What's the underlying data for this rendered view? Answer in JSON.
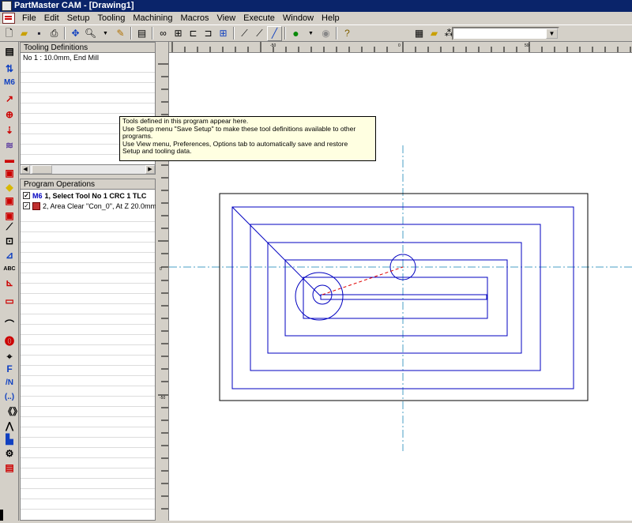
{
  "window": {
    "title": "PartMaster CAM - [Drawing1]"
  },
  "menu": [
    "File",
    "Edit",
    "Setup",
    "Tooling",
    "Machining",
    "Macros",
    "View",
    "Execute",
    "Window",
    "Help"
  ],
  "toolbar": {
    "icons": [
      "new-file-icon",
      "open-folder-icon",
      "save-icon",
      "print-icon",
      "pan-icon",
      "zoom-icon",
      "dropdown-arrow-icon",
      "pencil-icon",
      "grid-icon",
      "glasses-icon",
      "view-select-icon",
      "view-front-icon",
      "view-side-icon",
      "view-top-icon",
      "edit-curve-icon",
      "edit-shape-icon",
      "line-icon",
      "green-dot-icon",
      "dropdown-arrow-icon",
      "stop-icon",
      "help-icon",
      "settings-icon",
      "folder-icon",
      "network-icon",
      "window-icon"
    ],
    "combo_value": ""
  },
  "left_strip_icons": [
    "tool-list-icon",
    "axis-icon",
    "m6-icon",
    "arrow-icon",
    "circle-cross-icon",
    "drill-icon",
    "pattern-icon",
    "face-mill-icon",
    "pocket-icon",
    "profile-icon",
    "area-clear-icon",
    "engrave-icon",
    "pencil-icon",
    "box-icon",
    "slot-icon",
    "text-icon",
    "axis-angle-icon",
    "counter-icon",
    "coolant-icon",
    "stop-icon",
    "spindle-icon",
    "feed-icon",
    "sequence-icon",
    "bracket-icon",
    "comment-icon",
    "lightning-icon",
    "fixture-icon",
    "tool-change-icon",
    "program-icon"
  ],
  "left_strip_labels": {
    "m6": "M6",
    "feed": "F",
    "sequence": "/N",
    "bracket": "(..)"
  },
  "tooling_panel": {
    "title": "Tooling Definitions",
    "tools": [
      "No 1 : 10.0mm, End Mill"
    ]
  },
  "ops_panel": {
    "title": "Program Operations",
    "operations": [
      {
        "tag": "M6",
        "text": "1, Select Tool No 1 CRC 1 TLC",
        "checked": true
      },
      {
        "tag": "",
        "text": "2, Area Clear \"Con_0\", At Z 20.0mm",
        "checked": true
      }
    ]
  },
  "tooltip": {
    "lines": [
      "Tools defined in this program appear here.",
      "Use Setup menu \"Save Setup\" to make these tool definitions available to other",
      "programs.",
      "Use View menu, Preferences, Options tab to automatically save and restore",
      "Setup and tooling data."
    ]
  },
  "ruler_top_labels": [
    "-50",
    "0",
    "50"
  ],
  "ruler_left_labels": [
    "0",
    "-50"
  ],
  "colors": {
    "toolpath": "#0000c0",
    "centerline": "#4a9fc4",
    "rapid": "#e00000"
  }
}
